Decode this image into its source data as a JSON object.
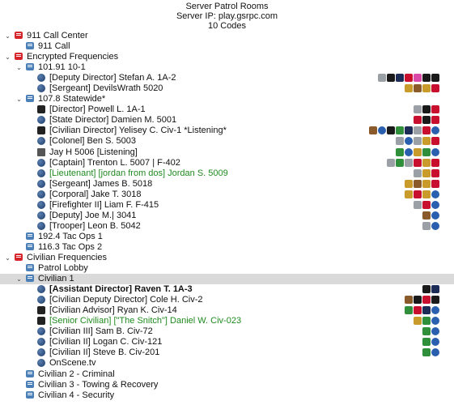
{
  "header": {
    "title": "Server Patrol Rooms",
    "ip": "Server IP: play.gsrpc.com",
    "codes": "10 Codes"
  },
  "rows": [
    {
      "depth": 0,
      "arrow": "down",
      "type": "channel",
      "color": "red",
      "label": "911 Call Center",
      "badges": []
    },
    {
      "depth": 1,
      "arrow": "",
      "type": "channel",
      "color": "blue",
      "label": "911 Call",
      "badges": []
    },
    {
      "depth": 0,
      "arrow": "down",
      "type": "channel",
      "color": "red",
      "label": "Encrypted Frequencies",
      "badges": []
    },
    {
      "depth": 1,
      "arrow": "down",
      "type": "channel",
      "color": "blue",
      "label": "101.91 10-1",
      "badges": []
    },
    {
      "depth": 2,
      "arrow": "",
      "type": "client",
      "status": "normal",
      "label": "[Deputy Director] Stefan A. 1A-2",
      "badges": [
        "gry",
        "blk",
        "navy",
        "red",
        "pink",
        "blk",
        "blk"
      ]
    },
    {
      "depth": 2,
      "arrow": "",
      "type": "client",
      "status": "normal",
      "label": "[Sergeant] DevilsWrath 5020",
      "badges": [
        "gold",
        "brn",
        "gold",
        "red"
      ]
    },
    {
      "depth": 1,
      "arrow": "down",
      "type": "channel",
      "color": "blue",
      "label": "107.8 Statewide*",
      "badges": []
    },
    {
      "depth": 2,
      "arrow": "",
      "type": "client",
      "status": "mute",
      "label": "[Director] Powell L. 1A-1",
      "badges": [
        "gry",
        "blk",
        "red"
      ]
    },
    {
      "depth": 2,
      "arrow": "",
      "type": "client",
      "status": "normal",
      "label": "[State Director] Damien M. 5001",
      "badges": [
        "red",
        "blk",
        "red"
      ]
    },
    {
      "depth": 2,
      "arrow": "",
      "type": "client",
      "status": "mute",
      "label": "[Civilian Director] Yelisey C. Civ-1 *Listening*",
      "badges": [
        "brn",
        "blue",
        "blk",
        "grn",
        "navy",
        "gry",
        "red",
        "blue"
      ]
    },
    {
      "depth": 2,
      "arrow": "",
      "type": "client",
      "status": "normal",
      "label": "[Colonel] Ben S. 5003",
      "badges": [
        "gry",
        "blue",
        "gry",
        "gold",
        "red"
      ]
    },
    {
      "depth": 2,
      "arrow": "",
      "type": "client",
      "status": "away",
      "label": "Jay H 5006 [Listening]",
      "badges": [
        "grn",
        "blue",
        "gold",
        "grn",
        "blue"
      ]
    },
    {
      "depth": 2,
      "arrow": "",
      "type": "client",
      "status": "normal",
      "label": "[Captain] Trenton L. 5007 | F-402",
      "badges": [
        "gry",
        "grn",
        "gry",
        "red",
        "gold",
        "red"
      ]
    },
    {
      "depth": 2,
      "arrow": "",
      "type": "client",
      "status": "normal",
      "label": "[Lieutenant] [jordan from dos] Jordan S. 5009",
      "green": true,
      "badges": [
        "gry",
        "gold",
        "red"
      ]
    },
    {
      "depth": 2,
      "arrow": "",
      "type": "client",
      "status": "normal",
      "label": "[Sergeant] James B. 5018",
      "badges": [
        "gold",
        "brn",
        "gold",
        "red"
      ]
    },
    {
      "depth": 2,
      "arrow": "",
      "type": "client",
      "status": "normal",
      "label": "[Corporal] Jake T. 3018",
      "badges": [
        "gold",
        "red",
        "gold",
        "blue"
      ]
    },
    {
      "depth": 2,
      "arrow": "",
      "type": "client",
      "status": "normal",
      "label": "[Firefighter II] Liam F. F-415",
      "badges": [
        "gry",
        "red",
        "blue"
      ]
    },
    {
      "depth": 2,
      "arrow": "",
      "type": "client",
      "status": "normal",
      "label": "[Deputy] Joe M.| 3041",
      "badges": [
        "brn",
        "blue"
      ]
    },
    {
      "depth": 2,
      "arrow": "",
      "type": "client",
      "status": "normal",
      "label": "[Trooper] Leon B. 5042",
      "badges": [
        "gry",
        "blue"
      ]
    },
    {
      "depth": 1,
      "arrow": "",
      "type": "channel",
      "color": "blue",
      "label": "192.4 Tac Ops 1",
      "badges": []
    },
    {
      "depth": 1,
      "arrow": "",
      "type": "channel",
      "color": "blue",
      "label": "116.3 Tac Ops 2",
      "badges": []
    },
    {
      "depth": 0,
      "arrow": "down",
      "type": "channel",
      "color": "red",
      "label": "Civilian Frequencies",
      "badges": []
    },
    {
      "depth": 1,
      "arrow": "",
      "type": "channel",
      "color": "blue",
      "label": "Patrol Lobby",
      "badges": []
    },
    {
      "depth": 1,
      "arrow": "down",
      "type": "channel",
      "color": "blue",
      "label": "Civilian 1",
      "selected": true,
      "badges": []
    },
    {
      "depth": 2,
      "arrow": "",
      "type": "client",
      "status": "normal",
      "label": "[Assistant Director] Raven T. 1A-3",
      "bold": true,
      "badges": [
        "blk",
        "navy"
      ]
    },
    {
      "depth": 2,
      "arrow": "",
      "type": "client",
      "status": "normal",
      "label": "[Civilian Deputy Director] Cole H. Civ-2",
      "badges": [
        "brn",
        "blk",
        "red",
        "blk"
      ]
    },
    {
      "depth": 2,
      "arrow": "",
      "type": "client",
      "status": "mute",
      "label": "[Civilian Advisor] Ryan K. Civ-14",
      "badges": [
        "grn",
        "red",
        "navy",
        "blue"
      ]
    },
    {
      "depth": 2,
      "arrow": "",
      "type": "client",
      "status": "mute",
      "label": "[Senior Civilian] [\"The Snitch\"] Daniel W. Civ-023",
      "green": true,
      "badges": [
        "gold",
        "grn",
        "blue"
      ]
    },
    {
      "depth": 2,
      "arrow": "",
      "type": "client",
      "status": "normal",
      "label": "[Civilian III] Sam B. Civ-72",
      "badges": [
        "grn",
        "blue"
      ]
    },
    {
      "depth": 2,
      "arrow": "",
      "type": "client",
      "status": "normal",
      "label": "[Civilian II] Logan C. Civ-121",
      "badges": [
        "grn",
        "blue"
      ]
    },
    {
      "depth": 2,
      "arrow": "",
      "type": "client",
      "status": "normal",
      "label": "[Civilian II] Steve B. Civ-201",
      "badges": [
        "grn",
        "blue"
      ]
    },
    {
      "depth": 2,
      "arrow": "",
      "type": "client",
      "status": "normal",
      "label": "OnScene.tv",
      "badges": []
    },
    {
      "depth": 1,
      "arrow": "",
      "type": "channel",
      "color": "blue",
      "label": "Civilian 2 - Criminal",
      "badges": []
    },
    {
      "depth": 1,
      "arrow": "",
      "type": "channel",
      "color": "blue",
      "label": "Civilian 3 - Towing & Recovery",
      "badges": []
    },
    {
      "depth": 1,
      "arrow": "",
      "type": "channel",
      "color": "blue",
      "label": "Civilian 4 - Security",
      "badges": []
    }
  ]
}
